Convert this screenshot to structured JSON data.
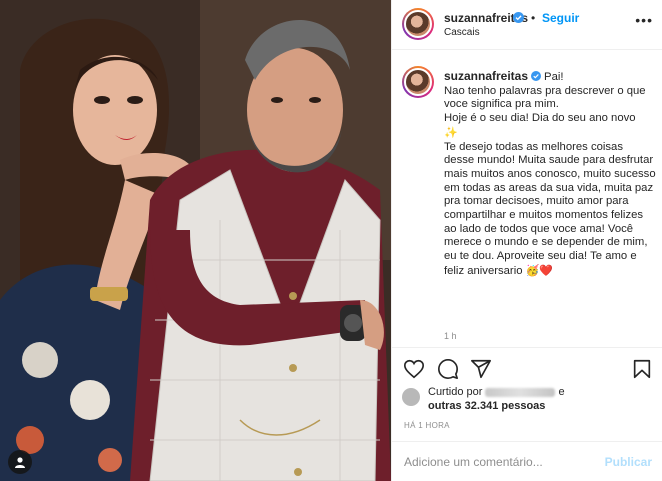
{
  "post": {
    "username": "suzannafreitas",
    "follow_label": "Seguir",
    "separator": "•",
    "location": "Cascais",
    "more_label": "•••"
  },
  "caption": {
    "username": "suzannafreitas",
    "text_1": "Pai!",
    "text_2": "Nao tenho palavras pra descrever o que voce significa pra mim.",
    "text_3": "Hoje é o seu dia! Dia do seu ano novo",
    "text_4": "Te desejo todas as melhores coisas desse mundo! Muita saude para desfrutar mais muitos anos conosco, muito sucesso em todas as areas da sua vida, muita paz pra tomar decisoes, muito amor para compartilhar e muitos momentos felizes ao lado de todos que voce ama! Você merece o mundo e se depender de mim, eu te dou. Aproveite seu dia! Te amo e feliz aniversario",
    "emoji_sparkle": "✨",
    "emoji_end": "🥳❤️",
    "time_ago": "1 h"
  },
  "likes": {
    "prefix": "Curtido por",
    "connector": "e",
    "others": "outras 32.341 pessoas"
  },
  "posted_label": "HÁ 1 HORA",
  "comment": {
    "placeholder": "Adicione um comentário...",
    "publish_label": "Publicar"
  },
  "colors": {
    "accent": "#0095f6",
    "publish_disabled": "#b2dffc",
    "heart": "#ed4956"
  },
  "icons": [
    "verified-icon",
    "more-icon",
    "heart-icon",
    "comment-icon",
    "share-icon",
    "bookmark-icon",
    "user-tag-icon"
  ]
}
